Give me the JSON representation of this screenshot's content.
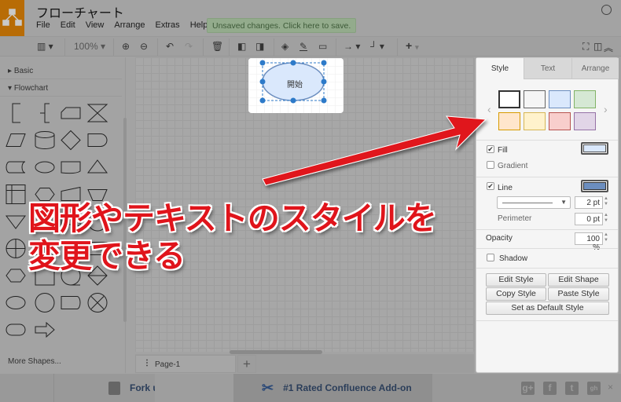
{
  "app": {
    "title": "フローチャート",
    "menu": [
      "File",
      "Edit",
      "View",
      "Arrange",
      "Extras",
      "Help"
    ],
    "unsaved": "Unsaved changes. Click here to save.",
    "logo_color": "#F08705"
  },
  "toolbar": {
    "zoom": "100%",
    "icons": [
      "format-panel-icon",
      "zoom-in-icon",
      "zoom-out-icon",
      "undo-icon",
      "redo-icon",
      "delete-icon",
      "to-front-icon",
      "to-back-icon",
      "fill-color-icon",
      "line-color-icon",
      "shadow-icon",
      "connection-icon",
      "waypoints-icon",
      "insert-icon",
      "fullscreen-icon",
      "panel-toggle-icon",
      "collapse-icon"
    ]
  },
  "sidebar": {
    "sections": [
      "Basic",
      "Flowchart"
    ],
    "shapes": [
      "bracket-left",
      "bracket-mid",
      "card",
      "collate",
      "parallelogram",
      "cylinder",
      "diamond",
      "delay",
      "stored-data",
      "ellipse-ish",
      "tape",
      "triangle",
      "internal-storage",
      "hexagon",
      "manual-input",
      "trapezoid",
      "triangle-down",
      "document",
      "paper-tape",
      "circle",
      "or",
      "predefined",
      "annotation",
      "rect",
      "hexagon",
      "square",
      "circle-tail",
      "sort",
      "ellipse",
      "circle",
      "display",
      "summing-junction",
      "terminator",
      "arrow"
    ],
    "more": "More Shapes..."
  },
  "canvas": {
    "shape_label": "開始",
    "fill": "#dae8fc",
    "stroke": "#6c8ebf"
  },
  "pages": {
    "current": "Page-1"
  },
  "footer": {
    "github": "Fork us on GitHub",
    "confluence": "#1 Rated Confluence Add-on",
    "social": [
      "g+",
      "f",
      "t",
      "gh"
    ]
  },
  "panel": {
    "tabs": [
      "Style",
      "Text",
      "Arrange"
    ],
    "swatches": [
      [
        "#ffffff",
        "#333333"
      ],
      [
        "#f5f5f5",
        "#666666"
      ],
      [
        "#dae8fc",
        "#6c8ebf"
      ],
      [
        "#d5e8d4",
        "#82b366"
      ],
      [
        "#ffe6cc",
        "#d79b00"
      ],
      [
        "#fff2cc",
        "#d6b656"
      ],
      [
        "#f8cecc",
        "#b85450"
      ],
      [
        "#e1d5e7",
        "#9673a6"
      ]
    ],
    "fill": {
      "label": "Fill",
      "checked": true,
      "color": "#dae8fc"
    },
    "gradient": {
      "label": "Gradient",
      "checked": false
    },
    "line": {
      "label": "Line",
      "checked": true,
      "color": "#6c8ebf",
      "width": "2 pt"
    },
    "perimeter": {
      "label": "Perimeter",
      "value": "0 pt"
    },
    "opacity": {
      "label": "Opacity",
      "value": "100 %"
    },
    "shadow": {
      "label": "Shadow",
      "checked": false
    },
    "buttons": {
      "edit_style": "Edit Style",
      "edit_shape": "Edit Shape",
      "copy_style": "Copy Style",
      "paste_style": "Paste Style",
      "default_style": "Set as Default Style"
    }
  },
  "annotation": {
    "line1": "図形やテキストのスタイルを",
    "line2": "変更できる",
    "color": "#e0141b"
  }
}
